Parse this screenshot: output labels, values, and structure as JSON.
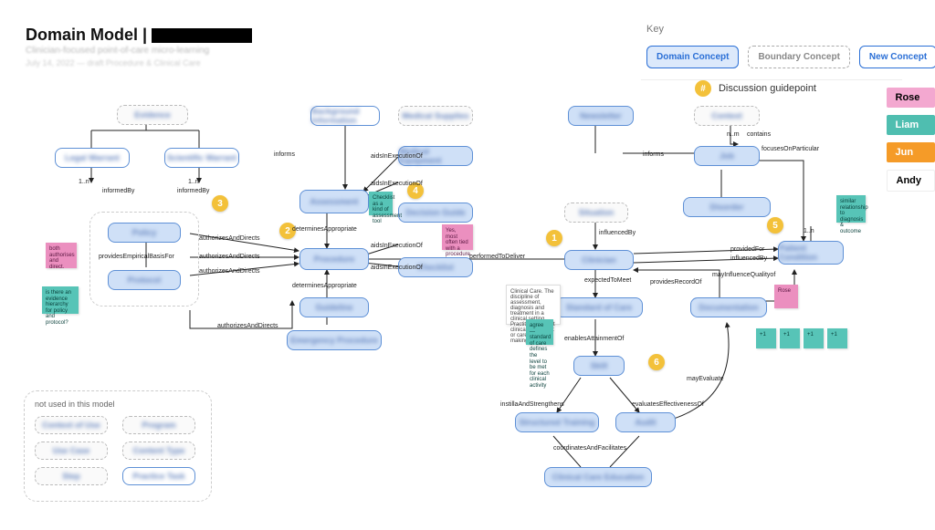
{
  "header": {
    "title_prefix": "Domain Model | ",
    "subtitle_blur_1": "Clinician-focused point-of-care micro-learning",
    "subtitle_blur_2": "July 14, 2022 — draft Procedure & Clinical Care"
  },
  "key": {
    "title": "Key",
    "domain": "Domain Concept",
    "boundary": "Boundary Concept",
    "newc": "New Concept",
    "disc_symbol": "#",
    "disc_label": "Discussion guidepoint"
  },
  "people": {
    "rose": "Rose",
    "liam": "Liam",
    "jun": "Jun",
    "andy": "Andy"
  },
  "guidepoints": {
    "g1": "1",
    "g2": "2",
    "g3": "3",
    "g4": "4",
    "g5": "5",
    "g6": "6"
  },
  "boxes": {
    "evidence": "Evidence",
    "legal": "Legal Warrant",
    "scientific": "Scientific Warrant",
    "policy": "Policy",
    "protocol": "Protocol",
    "bg_info": "Background Information",
    "assessment": "Assessment",
    "procedure": "Procedure",
    "guideline": "Guideline",
    "emergency": "Emergency Procedure",
    "med_supplies": "Medical Supplies",
    "med_equipment": "Medical Equipment",
    "decision_guide": "Decision Guide",
    "checklist": "Checklist",
    "newsletter": "Newsletter",
    "context": "Context",
    "clinician": "Clinician",
    "standard_of_care": "Standard of Care",
    "skill": "Skill",
    "structured_training": "Structured Training",
    "audit": "Audit",
    "clinical_care_edu": "Clinical Care Education",
    "job": "Job",
    "disorder": "Disorder",
    "patient_condition": "Patient Condition",
    "documentation": "Documentation",
    "situation": "Situation"
  },
  "unused": {
    "title": "not used in this model",
    "context_use": "Context of Use",
    "program": "Program",
    "use_case": "Use Case",
    "content_type": "Content Type",
    "step": "Step",
    "practice_task": "Practice Task"
  },
  "rel": {
    "informedBy": "informedBy",
    "providesEmpiricalBasisFor": "providesEmpiricalBasisFor",
    "authorizesAndDirects": "authorizesAndDirects",
    "determinesAppropriate": "determinesAppropriate",
    "informs": "informs",
    "aidsInExecutionOf": "aidsInExecutionOf",
    "performedToDeliver": "performedToDeliver",
    "influencedBy": "influencedBy",
    "expectedToMeet": "expectedToMeet",
    "enablesAttainmentOf": "enablesAttainmentOf",
    "instilsAndStrengthens": "instillaAndStrengthens",
    "evaluatesEffectivenessOf": "evaluatesEffectivenessOf",
    "coordinatesAndFacilitates": "coordinatesAndFacilitates",
    "mayEvaluate": "mayEvaluate",
    "providesRecordOf": "providesRecordOf",
    "mayInfluenceQualityOf": "mayInfluenceQualityof",
    "providedFor": "providedFor",
    "focusesOnParticular": "focusesOnParticular",
    "contains": "contains",
    "one_n": "1..n",
    "n_m": "n..m"
  },
  "stickies": {
    "s_pink_left": "both authorises and direct.",
    "s_teal_left": "is there an evidence hierarchy for policy and protocol?",
    "s_teal_assess": "Checklist as a kind of assessment tool",
    "s_pink_dec": "Yes, most often tied with a procedure.",
    "s_white_note": "Clinical Care. The discipline of assessment, diagnosis and treatment in a clinical setting. Practitioners call it clinical judgement or care decision making.",
    "s_teal_note2": "agree — standard of care defines the level to be met for each clinical activity",
    "s_pink_doc1": "Rose",
    "s_teal_doc1": "+1",
    "s_teal_doc2": "+1",
    "s_teal_doc3": "+1",
    "s_teal_doc4": "+1",
    "s_teal_pc": "similar relationship to diagnosis & outcome"
  }
}
